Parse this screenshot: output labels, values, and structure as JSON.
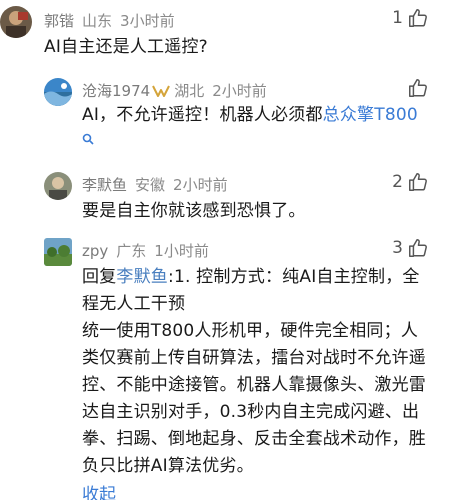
{
  "comments": [
    {
      "name": "郭锴",
      "region": "山东",
      "time": "3小时前",
      "text": "AI自主还是人工遥控?",
      "likes": "1"
    },
    {
      "name": "沧海1974",
      "region": "湖北",
      "time": "2小时前",
      "text_prefix": "AI，不允许遥控！机器人必须都",
      "text_link": "总众擎T800",
      "likes": ""
    },
    {
      "name": "李默鱼",
      "region": "安徽",
      "time": "2小时前",
      "text": "要是自主你就该感到恐惧了。",
      "likes": "2"
    },
    {
      "name": "zpy",
      "region": "广东",
      "time": "1小时前",
      "reply_prefix": "回复",
      "reply_to": "李默鱼",
      "lines": [
        ":1. 控制方式：纯AI自主控制，全",
        "程无人工干预",
        "统一使用T800人形机甲，硬件完全相同；人",
        "类仅赛前上传自研算法，擂台对战时不允许遥",
        "控、不能中途接管。机器人靠摄像头、激光雷",
        "达自主识别对手，0.3秒内自主完成闪避、出",
        "拳、扫踢、倒地起身、反击全套战术动作，胜",
        "负只比拼AI算法优劣。"
      ],
      "collapse_label": "收起",
      "likes": "3"
    }
  ]
}
